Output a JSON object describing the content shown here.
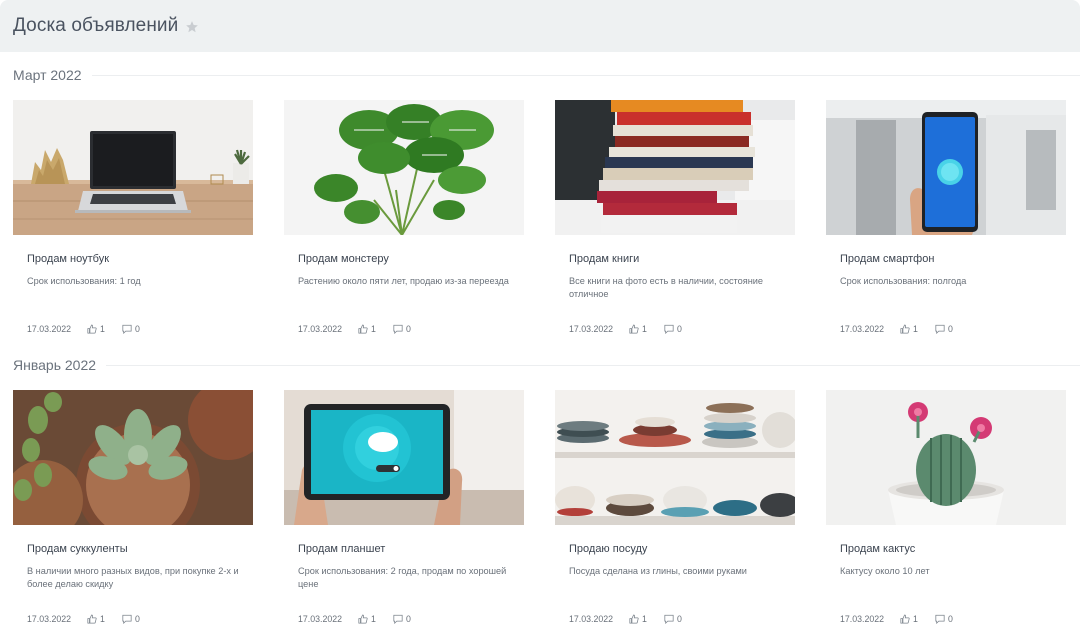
{
  "header": {
    "title": "Доска объявлений",
    "favorite_icon": "star-icon"
  },
  "sections": [
    {
      "title": "Март 2022",
      "cards": [
        {
          "title": "Продам ноутбук",
          "description": "Срок использования: 1 год",
          "date": "17.03.2022",
          "likes": "1",
          "comments": "0",
          "image": "laptop-photo"
        },
        {
          "title": "Продам монстеру",
          "description": "Растению около пяти лет, продаю из-за переезда",
          "date": "17.03.2022",
          "likes": "1",
          "comments": "0",
          "image": "monstera-photo"
        },
        {
          "title": "Продам книги",
          "description": "Все книги на фото есть в наличии, состояние отличное",
          "date": "17.03.2022",
          "likes": "1",
          "comments": "0",
          "image": "books-photo"
        },
        {
          "title": "Продам смартфон",
          "description": "Срок использования: полгода",
          "date": "17.03.2022",
          "likes": "1",
          "comments": "0",
          "image": "smartphone-photo"
        }
      ]
    },
    {
      "title": "Январь 2022",
      "cards": [
        {
          "title": "Продам суккуленты",
          "description": "В наличии много разных видов, при покупке 2-х и более делаю скидку",
          "date": "17.03.2022",
          "likes": "1",
          "comments": "0",
          "image": "succulents-photo"
        },
        {
          "title": "Продам планшет",
          "description": "Срок использования: 2 года, продам по хорошей цене",
          "date": "17.03.2022",
          "likes": "1",
          "comments": "0",
          "image": "tablet-photo"
        },
        {
          "title": "Продаю посуду",
          "description": "Посуда сделана из глины, своими руками",
          "date": "17.03.2022",
          "likes": "1",
          "comments": "0",
          "image": "dishes-photo"
        },
        {
          "title": "Продам кактус",
          "description": "Кактусу около 10 лет",
          "date": "17.03.2022",
          "likes": "1",
          "comments": "0",
          "image": "cactus-photo"
        }
      ]
    }
  ]
}
